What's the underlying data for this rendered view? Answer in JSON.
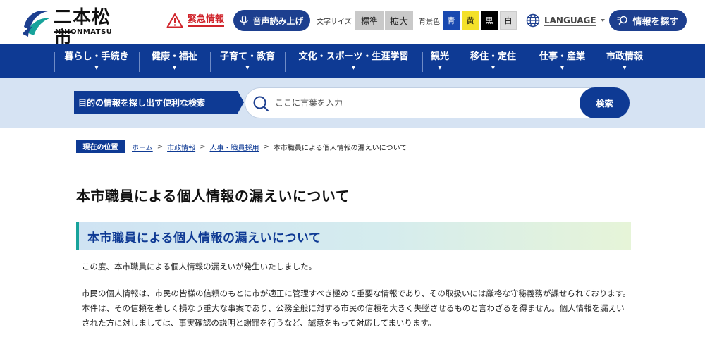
{
  "header": {
    "logo_jp": "二本松市",
    "logo_en": "NIHONMATSU",
    "emergency_label": "緊急情報",
    "voice_label": "音声読み上げ",
    "font_size_label": "文字サイズ",
    "font_size_options": [
      "標準",
      "拡大"
    ],
    "bg_color_label": "背景色",
    "bg_color_options": [
      "青",
      "黄",
      "黒",
      "白"
    ],
    "language_label": "LANGUAGE",
    "find_info_label": "情報を探す",
    "colors": {
      "brand": "#0e3a94",
      "emergency": "#d0242b",
      "accent": "#17a39b"
    }
  },
  "nav": {
    "items": [
      {
        "label": "暮らし・手続き"
      },
      {
        "label": "健康・福祉"
      },
      {
        "label": "子育て・教育"
      },
      {
        "label": "文化・スポーツ・生涯学習"
      },
      {
        "label": "観光"
      },
      {
        "label": "移住・定住"
      },
      {
        "label": "仕事・産業"
      },
      {
        "label": "市政情報"
      }
    ]
  },
  "search": {
    "tag": "目的の情報を探し出す便利な検索",
    "placeholder": "ここに言葉を入力",
    "button": "検索"
  },
  "breadcrumb": {
    "label": "現在の位置",
    "items": [
      "ホーム",
      "市政情報",
      "人事・職員採用",
      "本市職員による個人情報の漏えいについて"
    ]
  },
  "main": {
    "title": "本市職員による個人情報の漏えいについて",
    "section_heading": "本市職員による個人情報の漏えいについて",
    "paragraphs": [
      "この度、本市職員による個人情報の漏えいが発生いたしました。",
      "市民の個人情報は、市民の皆様の信頼のもとに市が適正に管理すべき極めて重要な情報であり、その取扱いには厳格な守秘義務が課せられております。本件は、その信頼を著しく損なう重大な事案であり、公務全般に対する市民の信頼を大きく失墜させるものと言わざるを得ません。個人情報を漏えいされた方に対しましては、事実確認の説明と謝罪を行うなど、誠意をもって対応してまいります。"
    ]
  }
}
